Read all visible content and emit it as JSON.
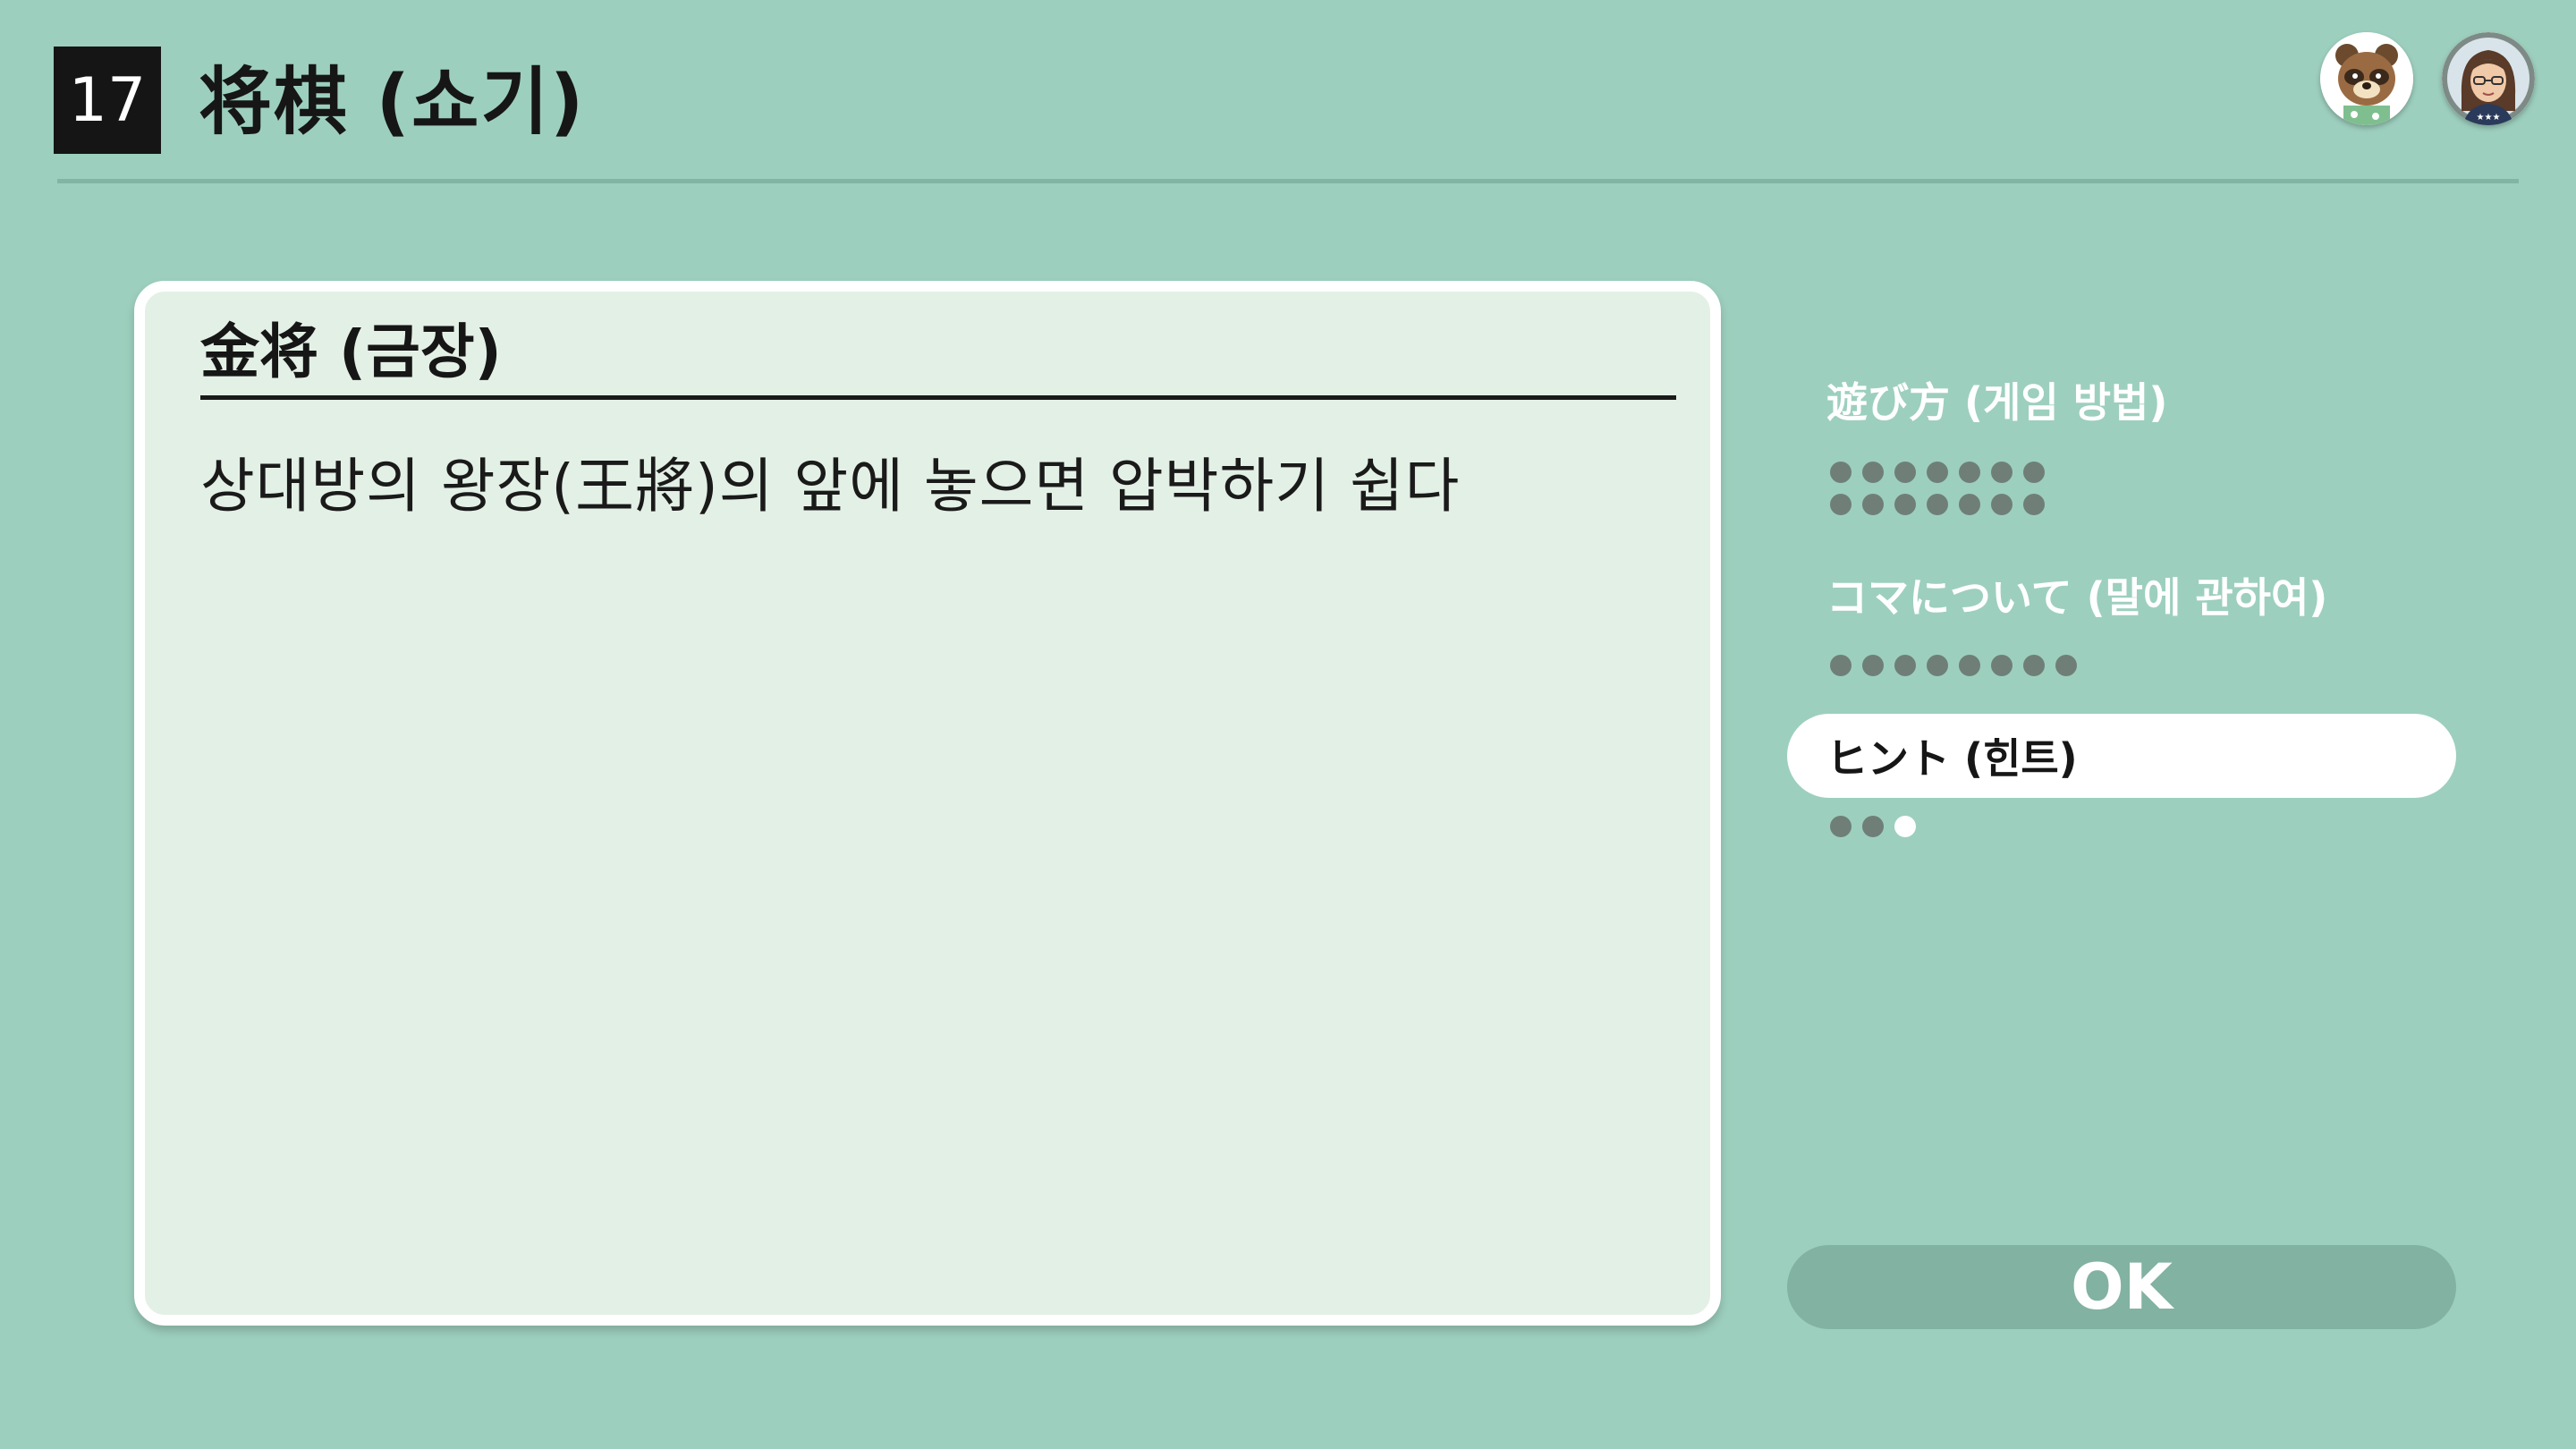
{
  "header": {
    "game_number": "17",
    "title": "将棋 (쇼기)"
  },
  "avatars": [
    {
      "icon": "tanuki-character-avatar-icon"
    },
    {
      "icon": "user-mii-avatar-icon"
    }
  ],
  "panel": {
    "heading": "金将 (금장)",
    "body": "상대방의 왕장(王將)의 앞에 놓으면 압박하기 쉽다"
  },
  "menu": {
    "items": [
      {
        "label": "遊び方 (게임 방법)",
        "selected": false,
        "page_count": 14,
        "current_page": null
      },
      {
        "label": "コマについて (말에 관하여)",
        "selected": false,
        "page_count": 8,
        "current_page": null
      },
      {
        "label": "ヒント (힌트)",
        "selected": true,
        "page_count": 3,
        "current_page": 3
      }
    ]
  },
  "ok_button": {
    "label": "OK"
  },
  "colors": {
    "background": "#9dcfbe",
    "panel": "#e3f0e6",
    "dot_inactive": "#6f7f78",
    "dot_active": "#ffffff",
    "ok_button": "#82b2a1",
    "header_rule": "#83b5a4"
  }
}
